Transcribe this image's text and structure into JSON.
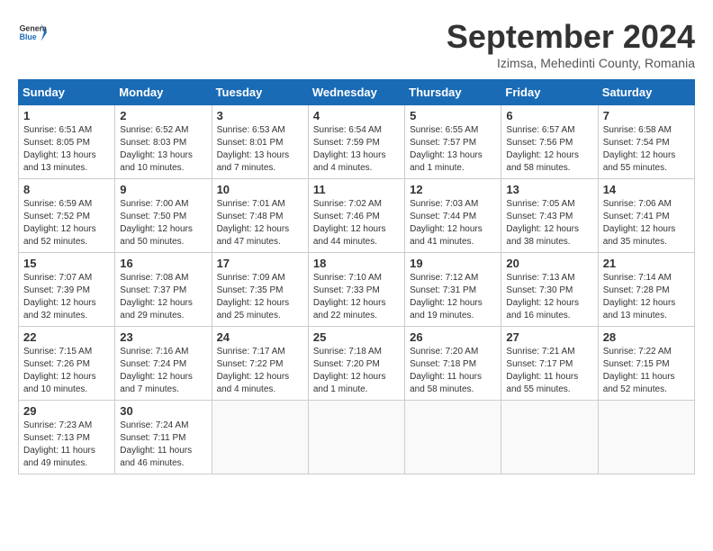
{
  "header": {
    "logo_general": "General",
    "logo_blue": "Blue",
    "month_title": "September 2024",
    "location": "Izimsa, Mehedinti County, Romania"
  },
  "calendar": {
    "weekdays": [
      "Sunday",
      "Monday",
      "Tuesday",
      "Wednesday",
      "Thursday",
      "Friday",
      "Saturday"
    ],
    "weeks": [
      [
        null,
        null,
        null,
        null,
        null,
        null,
        null
      ]
    ],
    "days": [
      {
        "num": "1",
        "info": "Sunrise: 6:51 AM\nSunset: 8:05 PM\nDaylight: 13 hours\nand 13 minutes.",
        "col": 0
      },
      {
        "num": "2",
        "info": "Sunrise: 6:52 AM\nSunset: 8:03 PM\nDaylight: 13 hours\nand 10 minutes.",
        "col": 1
      },
      {
        "num": "3",
        "info": "Sunrise: 6:53 AM\nSunset: 8:01 PM\nDaylight: 13 hours\nand 7 minutes.",
        "col": 2
      },
      {
        "num": "4",
        "info": "Sunrise: 6:54 AM\nSunset: 7:59 PM\nDaylight: 13 hours\nand 4 minutes.",
        "col": 3
      },
      {
        "num": "5",
        "info": "Sunrise: 6:55 AM\nSunset: 7:57 PM\nDaylight: 13 hours\nand 1 minute.",
        "col": 4
      },
      {
        "num": "6",
        "info": "Sunrise: 6:57 AM\nSunset: 7:56 PM\nDaylight: 12 hours\nand 58 minutes.",
        "col": 5
      },
      {
        "num": "7",
        "info": "Sunrise: 6:58 AM\nSunset: 7:54 PM\nDaylight: 12 hours\nand 55 minutes.",
        "col": 6
      },
      {
        "num": "8",
        "info": "Sunrise: 6:59 AM\nSunset: 7:52 PM\nDaylight: 12 hours\nand 52 minutes.",
        "col": 0
      },
      {
        "num": "9",
        "info": "Sunrise: 7:00 AM\nSunset: 7:50 PM\nDaylight: 12 hours\nand 50 minutes.",
        "col": 1
      },
      {
        "num": "10",
        "info": "Sunrise: 7:01 AM\nSunset: 7:48 PM\nDaylight: 12 hours\nand 47 minutes.",
        "col": 2
      },
      {
        "num": "11",
        "info": "Sunrise: 7:02 AM\nSunset: 7:46 PM\nDaylight: 12 hours\nand 44 minutes.",
        "col": 3
      },
      {
        "num": "12",
        "info": "Sunrise: 7:03 AM\nSunset: 7:44 PM\nDaylight: 12 hours\nand 41 minutes.",
        "col": 4
      },
      {
        "num": "13",
        "info": "Sunrise: 7:05 AM\nSunset: 7:43 PM\nDaylight: 12 hours\nand 38 minutes.",
        "col": 5
      },
      {
        "num": "14",
        "info": "Sunrise: 7:06 AM\nSunset: 7:41 PM\nDaylight: 12 hours\nand 35 minutes.",
        "col": 6
      },
      {
        "num": "15",
        "info": "Sunrise: 7:07 AM\nSunset: 7:39 PM\nDaylight: 12 hours\nand 32 minutes.",
        "col": 0
      },
      {
        "num": "16",
        "info": "Sunrise: 7:08 AM\nSunset: 7:37 PM\nDaylight: 12 hours\nand 29 minutes.",
        "col": 1
      },
      {
        "num": "17",
        "info": "Sunrise: 7:09 AM\nSunset: 7:35 PM\nDaylight: 12 hours\nand 25 minutes.",
        "col": 2
      },
      {
        "num": "18",
        "info": "Sunrise: 7:10 AM\nSunset: 7:33 PM\nDaylight: 12 hours\nand 22 minutes.",
        "col": 3
      },
      {
        "num": "19",
        "info": "Sunrise: 7:12 AM\nSunset: 7:31 PM\nDaylight: 12 hours\nand 19 minutes.",
        "col": 4
      },
      {
        "num": "20",
        "info": "Sunrise: 7:13 AM\nSunset: 7:30 PM\nDaylight: 12 hours\nand 16 minutes.",
        "col": 5
      },
      {
        "num": "21",
        "info": "Sunrise: 7:14 AM\nSunset: 7:28 PM\nDaylight: 12 hours\nand 13 minutes.",
        "col": 6
      },
      {
        "num": "22",
        "info": "Sunrise: 7:15 AM\nSunset: 7:26 PM\nDaylight: 12 hours\nand 10 minutes.",
        "col": 0
      },
      {
        "num": "23",
        "info": "Sunrise: 7:16 AM\nSunset: 7:24 PM\nDaylight: 12 hours\nand 7 minutes.",
        "col": 1
      },
      {
        "num": "24",
        "info": "Sunrise: 7:17 AM\nSunset: 7:22 PM\nDaylight: 12 hours\nand 4 minutes.",
        "col": 2
      },
      {
        "num": "25",
        "info": "Sunrise: 7:18 AM\nSunset: 7:20 PM\nDaylight: 12 hours\nand 1 minute.",
        "col": 3
      },
      {
        "num": "26",
        "info": "Sunrise: 7:20 AM\nSunset: 7:18 PM\nDaylight: 11 hours\nand 58 minutes.",
        "col": 4
      },
      {
        "num": "27",
        "info": "Sunrise: 7:21 AM\nSunset: 7:17 PM\nDaylight: 11 hours\nand 55 minutes.",
        "col": 5
      },
      {
        "num": "28",
        "info": "Sunrise: 7:22 AM\nSunset: 7:15 PM\nDaylight: 11 hours\nand 52 minutes.",
        "col": 6
      },
      {
        "num": "29",
        "info": "Sunrise: 7:23 AM\nSunset: 7:13 PM\nDaylight: 11 hours\nand 49 minutes.",
        "col": 0
      },
      {
        "num": "30",
        "info": "Sunrise: 7:24 AM\nSunset: 7:11 PM\nDaylight: 11 hours\nand 46 minutes.",
        "col": 1
      }
    ]
  }
}
